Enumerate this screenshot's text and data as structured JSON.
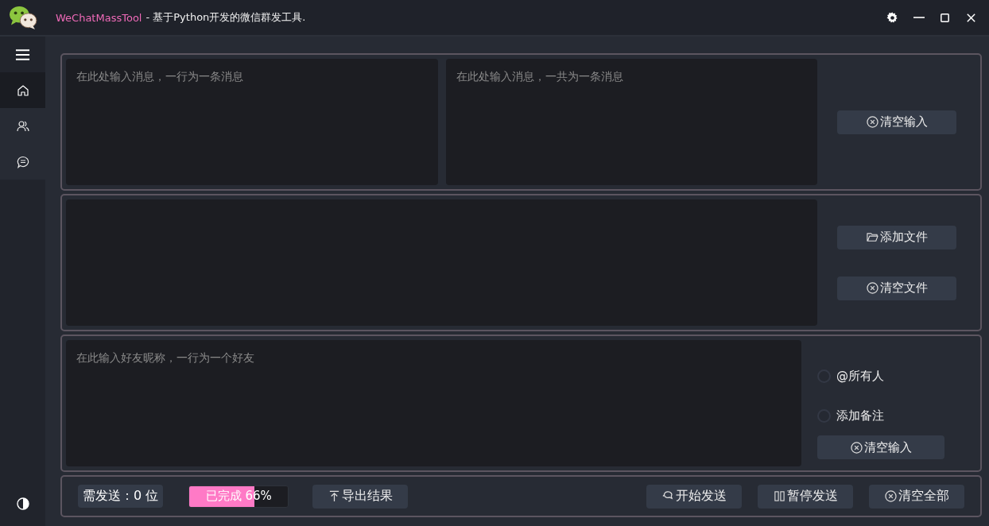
{
  "window": {
    "app_name": "WeChatMassTool",
    "subtitle": "- 基于Python开发的微信群发工具."
  },
  "sidebar": {
    "items": [
      {
        "selected": true
      },
      {
        "selected": false
      },
      {
        "selected": false
      }
    ]
  },
  "messages": {
    "fields": [
      {
        "placeholder": "在此处输入消息，一行为一条消息"
      },
      {
        "placeholder": "在此处输入消息，一共为一条消息"
      }
    ],
    "buttons": [
      {
        "kind": "clear",
        "label": "清空输入"
      }
    ]
  },
  "files": {
    "buttons": [
      {
        "kind": "add",
        "label": "添加文件"
      },
      {
        "kind": "clear",
        "label": "清空文件"
      }
    ]
  },
  "friends": {
    "field": {
      "placeholder": "在此输入好友昵称，一行为一个好友"
    },
    "options": [
      {
        "label": "@所有人",
        "checked": false
      },
      {
        "label": "添加备注",
        "checked": false
      }
    ],
    "buttons": [
      {
        "kind": "clear",
        "label": "清空输入"
      }
    ]
  },
  "footer": {
    "count": "需发送：0 位",
    "progress": {
      "text": "已完成 66%",
      "level": 0.66
    },
    "export": {
      "label": "导出结果"
    },
    "buttons": [
      {
        "kind": "start",
        "label": "开始发送"
      },
      {
        "kind": "pause",
        "label": "暂停发送"
      },
      {
        "kind": "clear",
        "label": "清空全部"
      }
    ]
  }
}
